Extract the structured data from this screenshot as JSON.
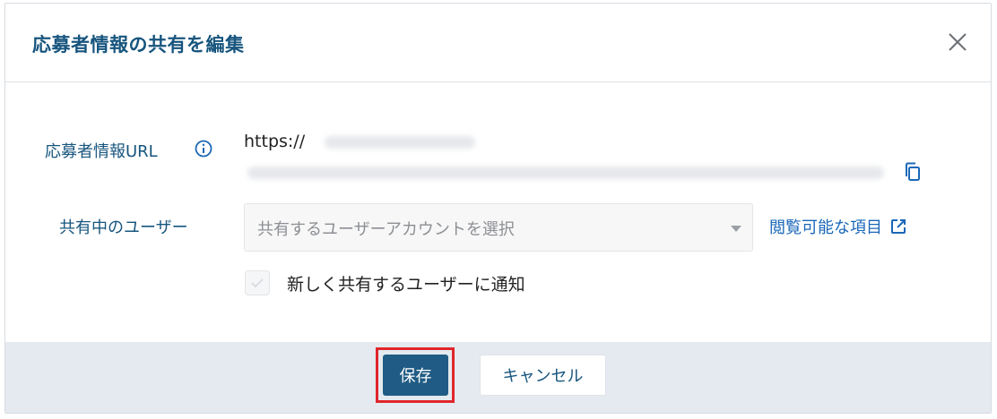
{
  "dialog": {
    "title": "応募者情報の共有を編集",
    "close_icon": "close-icon"
  },
  "url_row": {
    "label": "応募者情報URL",
    "info_icon": "info-icon",
    "url_prefix": "https://",
    "copy_icon": "copy-icon"
  },
  "users_row": {
    "label": "共有中のユーザー",
    "select_placeholder": "共有するユーザーアカウントを選択",
    "link_text": "閲覧可能な項目",
    "link_icon": "external-link-icon"
  },
  "notify": {
    "label": "新しく共有するユーザーに通知",
    "checked": false
  },
  "footer": {
    "save_label": "保存",
    "cancel_label": "キャンセル"
  },
  "colors": {
    "title": "#17557e",
    "primary_button": "#1f5b84",
    "link": "#1a67b8",
    "footer_bg": "#e4eaef",
    "highlight": "#e0262b"
  }
}
